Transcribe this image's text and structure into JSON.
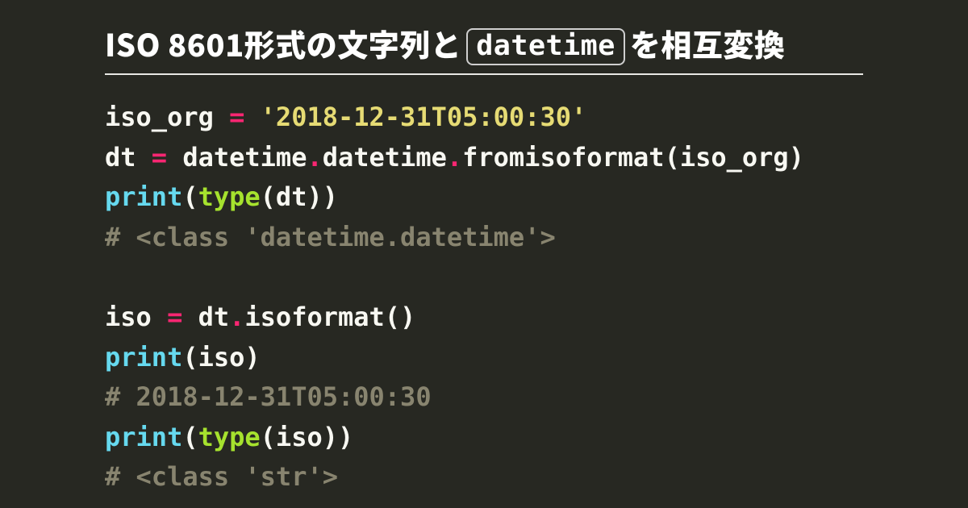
{
  "title": {
    "prefix": "ISO 8601形式の文字列と",
    "keyword": "datetime",
    "suffix": "を相互変換"
  },
  "code": {
    "lines": [
      [
        {
          "cls": "tok-default",
          "t": "iso_org "
        },
        {
          "cls": "tok-operator",
          "t": "="
        },
        {
          "cls": "tok-default",
          "t": " "
        },
        {
          "cls": "tok-string",
          "t": "'2018-12-31T05:00:30'"
        }
      ],
      [
        {
          "cls": "tok-default",
          "t": "dt "
        },
        {
          "cls": "tok-operator",
          "t": "="
        },
        {
          "cls": "tok-default",
          "t": " datetime"
        },
        {
          "cls": "tok-dot",
          "t": "."
        },
        {
          "cls": "tok-default",
          "t": "datetime"
        },
        {
          "cls": "tok-dot",
          "t": "."
        },
        {
          "cls": "tok-default",
          "t": "fromisoformat"
        },
        {
          "cls": "tok-punct",
          "t": "("
        },
        {
          "cls": "tok-default",
          "t": "iso_org"
        },
        {
          "cls": "tok-punct",
          "t": ")"
        }
      ],
      [
        {
          "cls": "tok-builtin",
          "t": "print"
        },
        {
          "cls": "tok-punct",
          "t": "("
        },
        {
          "cls": "tok-func",
          "t": "type"
        },
        {
          "cls": "tok-punct",
          "t": "("
        },
        {
          "cls": "tok-default",
          "t": "dt"
        },
        {
          "cls": "tok-punct",
          "t": ")"
        },
        {
          "cls": "tok-punct",
          "t": ")"
        }
      ],
      [
        {
          "cls": "tok-comment",
          "t": "# <class 'datetime.datetime'>"
        }
      ],
      [
        {
          "cls": "tok-default",
          "t": ""
        }
      ],
      [
        {
          "cls": "tok-default",
          "t": "iso "
        },
        {
          "cls": "tok-operator",
          "t": "="
        },
        {
          "cls": "tok-default",
          "t": " dt"
        },
        {
          "cls": "tok-dot",
          "t": "."
        },
        {
          "cls": "tok-default",
          "t": "isoformat"
        },
        {
          "cls": "tok-punct",
          "t": "()"
        }
      ],
      [
        {
          "cls": "tok-builtin",
          "t": "print"
        },
        {
          "cls": "tok-punct",
          "t": "("
        },
        {
          "cls": "tok-default",
          "t": "iso"
        },
        {
          "cls": "tok-punct",
          "t": ")"
        }
      ],
      [
        {
          "cls": "tok-comment",
          "t": "# 2018-12-31T05:00:30"
        }
      ],
      [
        {
          "cls": "tok-builtin",
          "t": "print"
        },
        {
          "cls": "tok-punct",
          "t": "("
        },
        {
          "cls": "tok-func",
          "t": "type"
        },
        {
          "cls": "tok-punct",
          "t": "("
        },
        {
          "cls": "tok-default",
          "t": "iso"
        },
        {
          "cls": "tok-punct",
          "t": ")"
        },
        {
          "cls": "tok-punct",
          "t": ")"
        }
      ],
      [
        {
          "cls": "tok-comment",
          "t": "# <class 'str'>"
        }
      ]
    ]
  }
}
